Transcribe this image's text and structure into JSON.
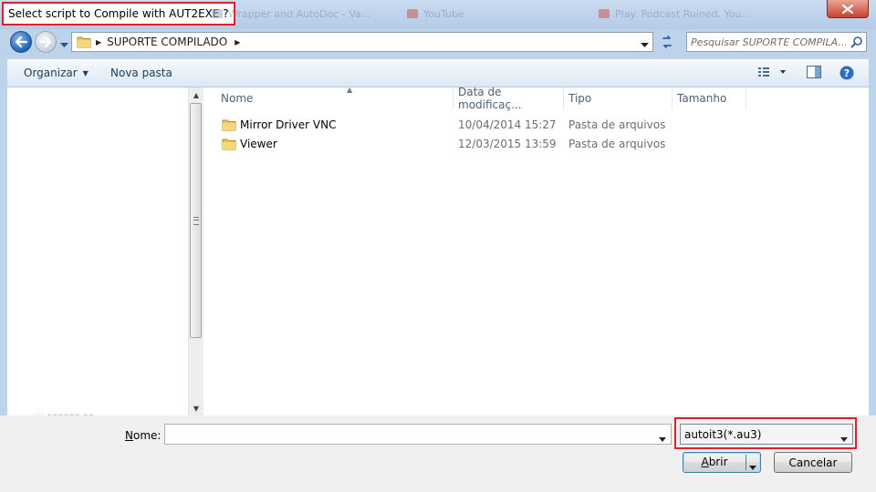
{
  "window": {
    "title": "Select script to Compile with AUT2EXE ?",
    "background_tabs": [
      "Wrapper and AutoDoc - Va...",
      "YouTube",
      "Play. Podcast Ruined. You..."
    ],
    "close_icon": "close-x-icon"
  },
  "navigation": {
    "back_icon": "back-arrow-icon",
    "forward_icon": "forward-arrow-icon",
    "history_icon": "chevron-down-icon",
    "address_path": "SUPORTE COMPILADO",
    "refresh_icon": "refresh-icon",
    "search_placeholder": "Pesquisar SUPORTE COMPILA...",
    "search_icon": "magnifier-icon"
  },
  "toolbar": {
    "organize_label": "Organizar",
    "new_folder_label": "Nova pasta",
    "view_icon": "details-view-icon",
    "preview_icon": "preview-pane-icon",
    "help_icon": "help-icon"
  },
  "file_list": {
    "columns": [
      "Nome",
      "Data de modificaç...",
      "Tipo",
      "Tamanho"
    ],
    "rows": [
      {
        "name": "Mirror Driver VNC",
        "date": "10/04/2014 15:27",
        "type": "Pasta de arquivos"
      },
      {
        "name": "Viewer",
        "date": "12/03/2015 13:59",
        "type": "Pasta de arquivos"
      }
    ]
  },
  "bottom": {
    "name_label_underlined": "N",
    "name_label_rest": "ome:",
    "name_value": "",
    "file_type_value": "autoit3(*.au3)",
    "open_label_underlined": "A",
    "open_label_rest": "brir",
    "cancel_label": "Cancelar"
  },
  "colors": {
    "highlight": "#e0202a",
    "frame": "#bcd3ea",
    "accent_blue": "#2160b6"
  }
}
